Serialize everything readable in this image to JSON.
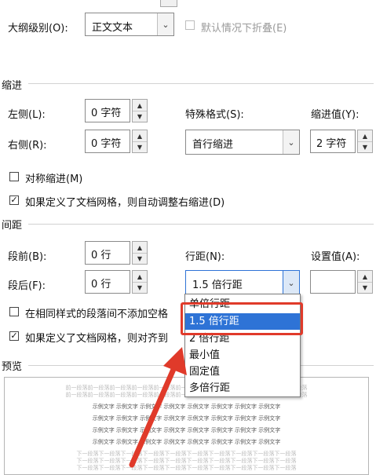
{
  "outline": {
    "label": "大纲级别(O):",
    "value": "正文文本",
    "collapse_label": "默认情况下折叠(E)"
  },
  "indent": {
    "section_title": "缩进",
    "left_label": "左侧(L):",
    "left_value": "0 字符",
    "right_label": "右侧(R):",
    "right_value": "0 字符",
    "special_label": "特殊格式(S):",
    "special_value": "首行缩进",
    "by_label": "缩进值(Y):",
    "by_value": "2 字符",
    "mirror_label": "对称缩进(M)",
    "mirror_checked": false,
    "grid_label": "如果定义了文档网格，则自动调整右缩进(D)",
    "grid_checked": true
  },
  "spacing": {
    "section_title": "间距",
    "before_label": "段前(B):",
    "before_value": "0 行",
    "after_label": "段后(F):",
    "after_value": "0 行",
    "line_label": "行距(N):",
    "line_value": "1.5 倍行距",
    "at_label": "设置值(A):",
    "at_value": "",
    "same_style_label": "在相同样式的段落间不添加空格",
    "same_style_checked": false,
    "snap_grid_label": "如果定义了文档网格，则对齐到",
    "snap_grid_checked": true
  },
  "dropdown": {
    "options": [
      "单倍行距",
      "1.5 倍行距",
      "2 倍行距",
      "最小值",
      "固定值",
      "多倍行距"
    ],
    "selected_index": 1
  },
  "preview": {
    "section_title": "预览",
    "prev_text": "前一段落前一段落前一段落前一段落前一段落前一段落前一段落前一段落前一段落前一段落前一段落",
    "sample_text": "示例文字 示例文字 示例文字 示例文字 示例文字 示例文字 示例文字 示例文字",
    "next_text": "下一段落下一段落下一段落下一段落下一段落下一段落下一段落下一段落下一段落下一段落"
  },
  "colors": {
    "highlight": "#2e73d6",
    "annotation": "#e03a2a"
  }
}
